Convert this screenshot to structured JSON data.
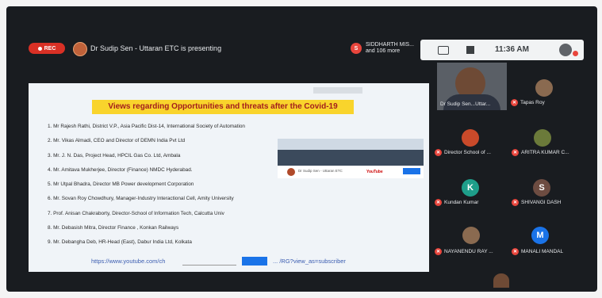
{
  "meeting": {
    "rec_label": "REC",
    "presenting_text": "Dr Sudip Sen - Uttaran ETC is presenting",
    "viewers_initial": "S",
    "viewers_text": "SIDDHARTH MIS... and 106 more",
    "clock": "11:36 AM"
  },
  "slide": {
    "headline": "Views regarding Opportunities and threats after the Covid-19",
    "speakers": [
      "1. Mr Rajesh Rathi, District V.P., Asia Pacific Dist-14, International Society of Automation",
      "2. Mr. Vikas Almadi, CEO and Director of DEMN India Pvt Ltd",
      "3. Mr. J. N. Das, Project Head, HPCIL Gas Co. Ltd, Ambala",
      "4. Mr. Amitava Mukherjee, Director (Finance) NMDC Hyderabad.",
      "5. Mr Utpal Bhadra, Director MB Power development Corporation",
      "6. Mr. Sovan Roy Chowdhury, Manager-Industry Interactional Cell, Amity University",
      "7. Prof. Anisan Chakraborty, Director-School of Information Tech, Calcutta Univ",
      "8. Mr. Debasish Mitra, Director Finance , Konkan Railways",
      "9. Mr. Debangha Deb, HR-Head (East), Dabur India Ltd, Kolkata"
    ],
    "thumb_channel": "Dr Sudip Sen - Uttaran ETC",
    "thumb_platform": "YouTube",
    "link_left": "https://www.youtube.com/ch",
    "link_right": "... /RG?view_as=subscriber"
  },
  "participants": {
    "self_label": "Dr Sudip Sen...Uttar...",
    "tiles": [
      {
        "name": "Tapas Roy",
        "initial": "",
        "color": "#8a6a50"
      },
      {
        "name": "Director School of ...",
        "initial": "",
        "color": "#c94a2a"
      },
      {
        "name": "ARITRA KUMAR C...",
        "initial": "",
        "color": "#6b7a3a"
      },
      {
        "name": "Kundan Kumar",
        "initial": "K",
        "color": "#1e9e8a"
      },
      {
        "name": "SHIVANGI DASH",
        "initial": "S",
        "color": "#6d4c41"
      },
      {
        "name": "NAYANENDU RAY ...",
        "initial": "",
        "color": "#8a6a50"
      },
      {
        "name": "MANALI MANDAL",
        "initial": "M",
        "color": "#1a73e8"
      }
    ]
  },
  "colors": {
    "mic_off": "#e8453c",
    "headline_bg": "#f9d42c",
    "headline_text": "#a31d1d"
  }
}
